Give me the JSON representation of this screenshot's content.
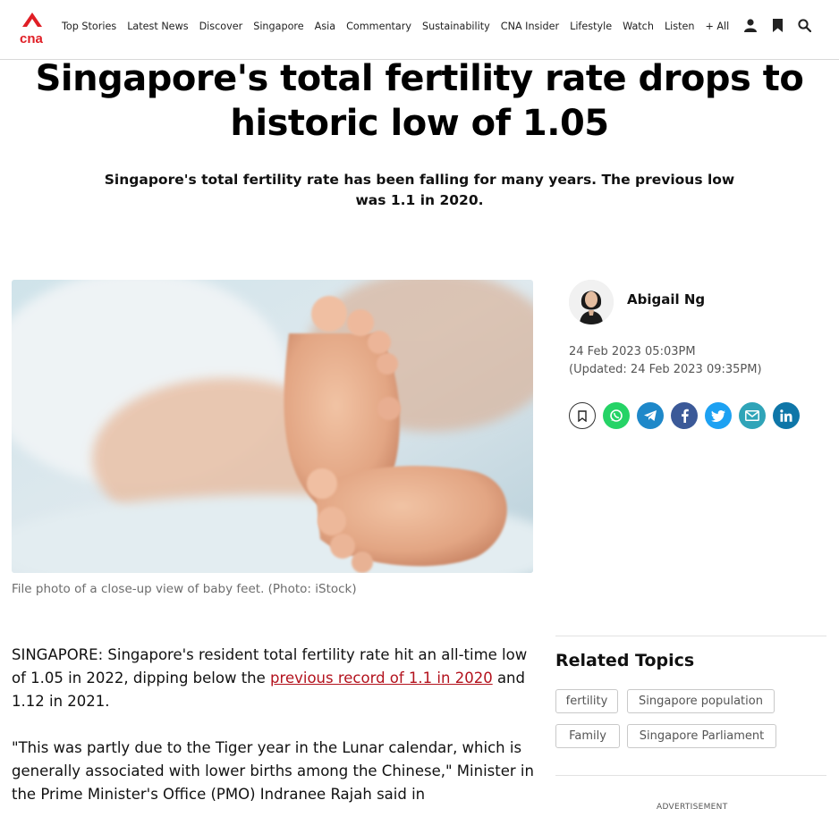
{
  "header": {
    "brand": "cna",
    "brand_color": "#e01e25",
    "nav": [
      {
        "label": "Top Stories"
      },
      {
        "label": "Latest News"
      },
      {
        "label": "Discover"
      },
      {
        "label": "Singapore"
      },
      {
        "label": "Asia"
      },
      {
        "label": "Commentary"
      },
      {
        "label": "Sustainability"
      },
      {
        "label": "CNA Insider"
      },
      {
        "label": "Lifestyle"
      },
      {
        "label": "Watch"
      },
      {
        "label": "Listen"
      },
      {
        "label": "+ All"
      }
    ],
    "icons": [
      "user-icon",
      "bookmark-icon",
      "search-icon"
    ]
  },
  "article": {
    "title": "Singapore's total fertility rate drops to historic low of 1.05",
    "summary": "Singapore's total fertility rate has been falling for many years. The previous low was 1.1 in 2020.",
    "photo_caption": "File photo of a close-up view of baby feet. (Photo: iStock)",
    "author": "Abigail Ng",
    "published": "24 Feb 2023 05:03PM",
    "updated": "(Updated: 24 Feb 2023 09:35PM)",
    "share_icons": [
      "bookmark-icon",
      "whatsapp-icon",
      "telegram-icon",
      "facebook-icon",
      "twitter-icon",
      "email-icon",
      "linkedin-icon"
    ],
    "para1_before": "SINGAPORE: Singapore's resident total fertility rate hit an all-time low of 1.05 in 2022, dipping below the ",
    "para1_link": "previous record of 1.1 in 2020",
    "para1_after": " and 1.12 in 2021.",
    "para2": "\"This was partly due to the Tiger year in the Lunar calendar, which is generally associated with lower births among the Chinese,\" Minister in the Prime Minister's Office (PMO) Indranee Rajah said in"
  },
  "related": {
    "title": "Related Topics",
    "tags": [
      {
        "label": "fertility"
      },
      {
        "label": "Singapore population"
      },
      {
        "label": "Family"
      },
      {
        "label": "Singapore Parliament"
      }
    ]
  },
  "ad_label": "ADVERTISEMENT",
  "colors": {
    "link": "#b3121d",
    "whatsapp": "#25d366",
    "telegram": "#1e88c9",
    "facebook": "#3b5998",
    "twitter": "#1da1f2",
    "email": "#2fa4b8",
    "linkedin": "#0e76a8"
  }
}
